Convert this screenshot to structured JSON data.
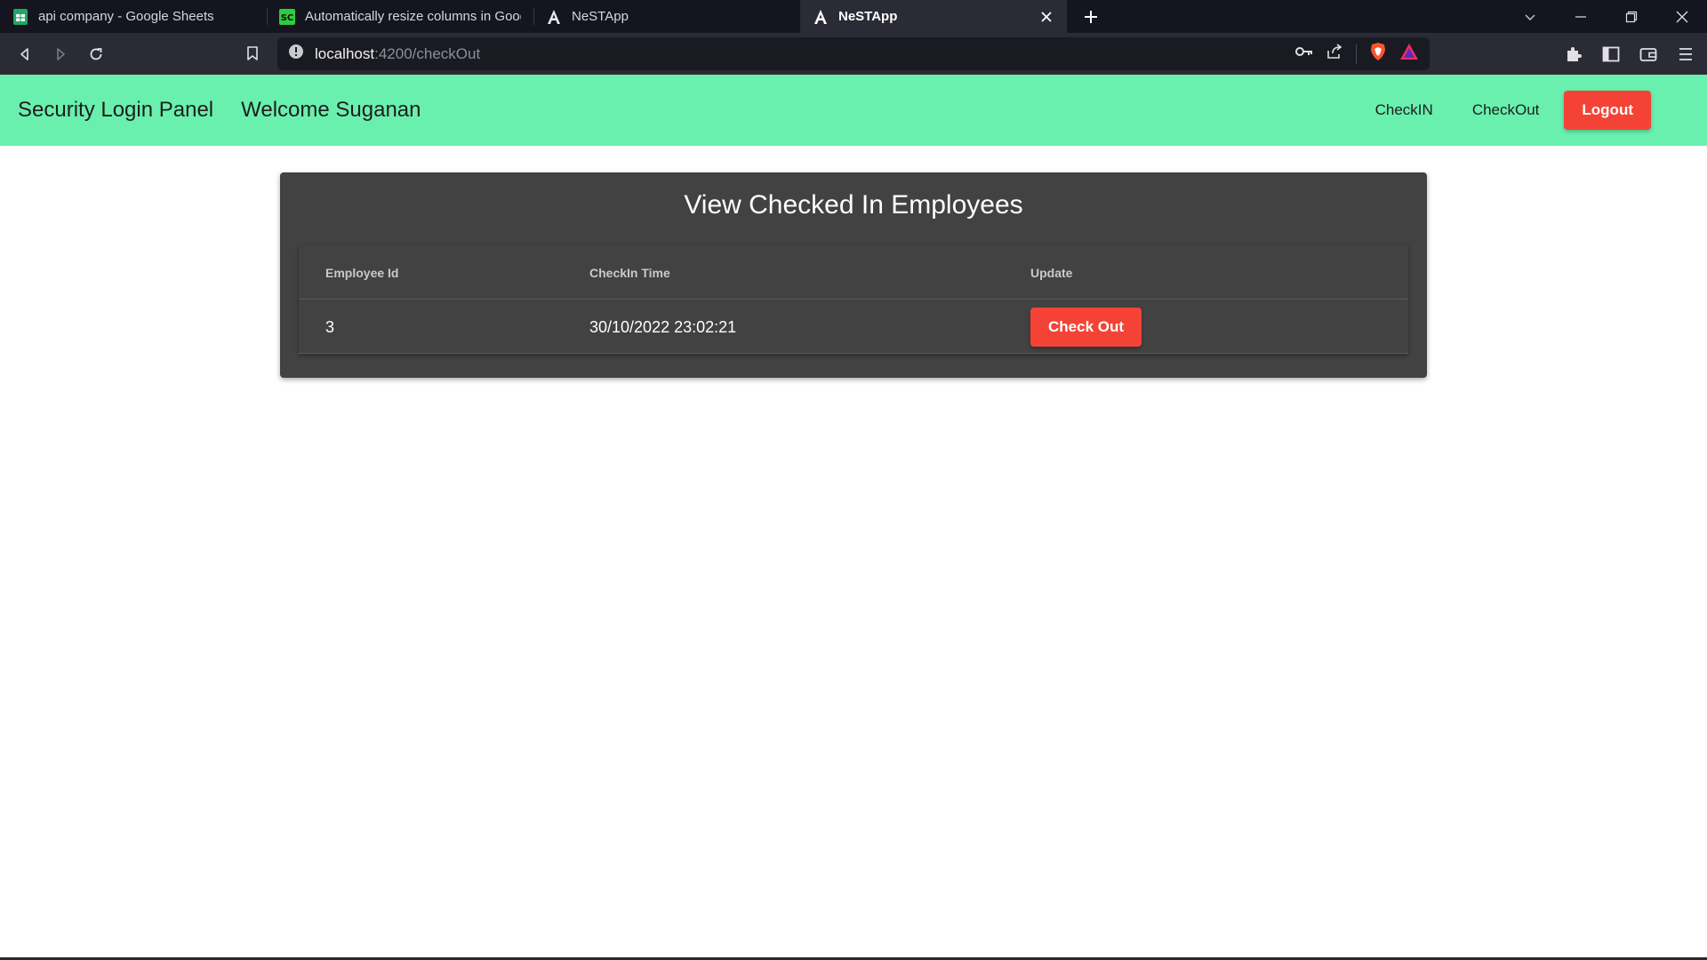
{
  "browser": {
    "tabs": [
      {
        "title": "api company - Google Sheets",
        "icon": "google-sheets-icon",
        "active": false
      },
      {
        "title": "Automatically resize columns in Googl",
        "icon": "sc-site-icon",
        "active": false
      },
      {
        "title": "NeSTApp",
        "icon": "angular-icon",
        "active": false
      },
      {
        "title": "NeSTApp",
        "icon": "angular-icon",
        "active": true
      }
    ],
    "address": {
      "host": "localhost",
      "rest": ":4200/checkOut"
    },
    "colors": {
      "tabstrip": "#15151f",
      "toolbar": "#2b2b36",
      "omnibox": "#1a1a23"
    }
  },
  "header": {
    "brand": "Security Login Panel",
    "welcome": "Welcome Suganan",
    "nav": {
      "checkin": "CheckIN",
      "checkout": "CheckOut",
      "logout": "Logout"
    },
    "colors": {
      "background": "#69f0ae",
      "logout": "#f44336"
    }
  },
  "card": {
    "title": "View Checked In Employees",
    "columns": [
      "Employee Id",
      "CheckIn Time",
      "Update"
    ],
    "rows": [
      {
        "employee_id": "3",
        "checkin_time": "30/10/2022 23:02:21",
        "action": "Check Out"
      }
    ],
    "colors": {
      "background": "#424242",
      "action": "#f44336"
    }
  }
}
